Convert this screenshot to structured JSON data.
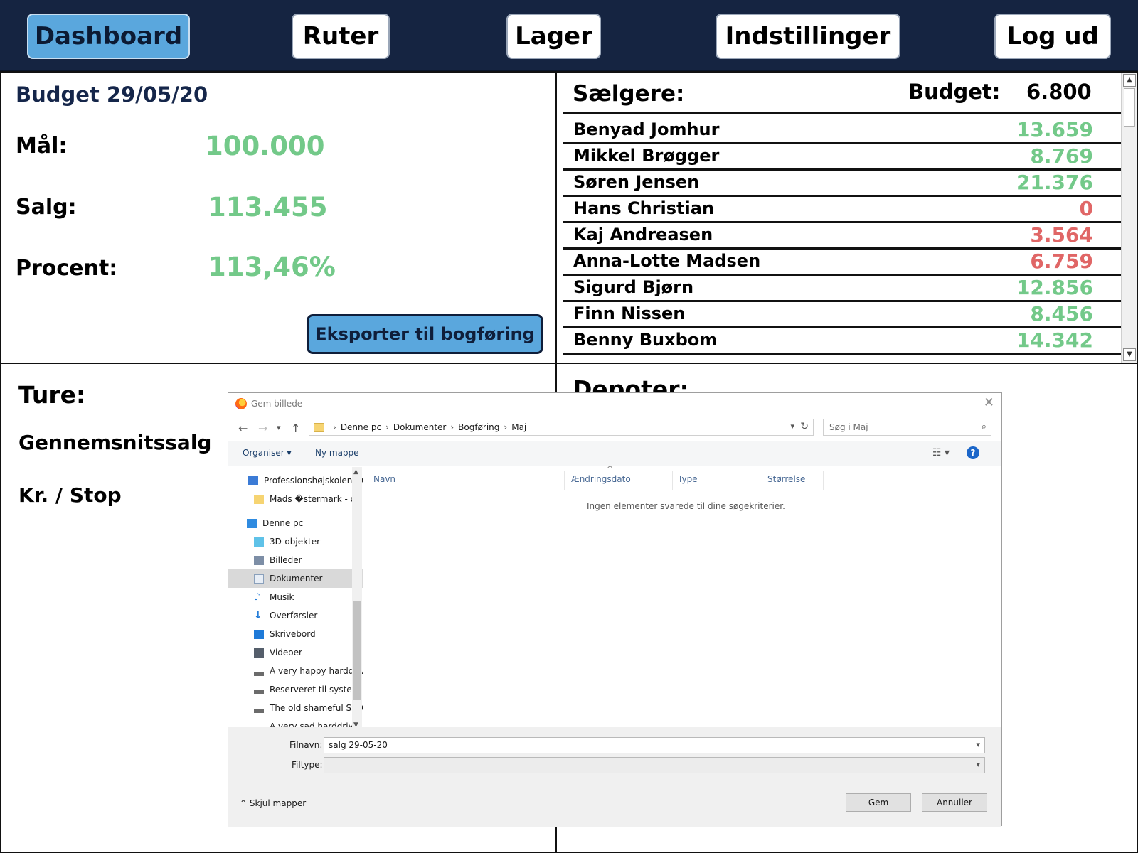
{
  "nav": {
    "items": [
      {
        "label": "Dashboard",
        "active": true
      },
      {
        "label": "Ruter"
      },
      {
        "label": "Lager"
      },
      {
        "label": "Indstillinger"
      },
      {
        "label": "Log ud"
      }
    ]
  },
  "budget": {
    "title": "Budget 29/05/20",
    "goal_label": "Mål:",
    "goal_value": "100.000",
    "sales_label": "Salg:",
    "sales_value": "113.455",
    "percent_label": "Procent:",
    "percent_value": "113,46%",
    "export_button": "Eksporter til bogføring"
  },
  "sellers": {
    "title": "Sælgere:",
    "budget_label": "Budget:",
    "budget_value": "6.800",
    "rows": [
      {
        "name": "Benyad Jomhur",
        "value": "13.659",
        "status": "green"
      },
      {
        "name": "Mikkel Brøgger",
        "value": "8.769",
        "status": "green"
      },
      {
        "name": "Søren Jensen",
        "value": "21.376",
        "status": "green"
      },
      {
        "name": "Hans Christian",
        "value": "0",
        "status": "red"
      },
      {
        "name": "Kaj Andreasen",
        "value": "3.564",
        "status": "red"
      },
      {
        "name": "Anna-Lotte Madsen",
        "value": "6.759",
        "status": "red"
      },
      {
        "name": "Sigurd Bjørn",
        "value": "12.856",
        "status": "green"
      },
      {
        "name": "Finn Nissen",
        "value": "8.456",
        "status": "green"
      },
      {
        "name": "Benny Buxbom",
        "value": "14.342",
        "status": "green"
      }
    ]
  },
  "tours": {
    "title": "Ture:",
    "avg_label": "Gennemsnitssalg",
    "per_stop_label": "Kr. / Stop"
  },
  "depots": {
    "title": "Depoter:"
  },
  "dialog": {
    "title": "Gem billede",
    "breadcrumbs": [
      "Denne pc",
      "Dokumenter",
      "Bogføring",
      "Maj"
    ],
    "search_placeholder": "Søg i Maj",
    "toolbar": {
      "organize": "Organiser",
      "new_folder": "Ny mappe"
    },
    "nav_items": [
      {
        "label": "Professionshøjskolen UCN",
        "icon": "building-icon"
      },
      {
        "label": "Mads �stermark - d",
        "icon": "folder-icon"
      },
      {
        "label": "Denne pc",
        "icon": "computer-icon"
      },
      {
        "label": "3D-objekter",
        "icon": "cube-icon"
      },
      {
        "label": "Billeder",
        "icon": "pictures-icon"
      },
      {
        "label": "Dokumenter",
        "icon": "documents-icon",
        "selected": true
      },
      {
        "label": "Musik",
        "icon": "music-icon"
      },
      {
        "label": "Overførsler",
        "icon": "download-icon"
      },
      {
        "label": "Skrivebord",
        "icon": "desktop-icon"
      },
      {
        "label": "Videoer",
        "icon": "video-icon"
      },
      {
        "label": "A very happy harddrive",
        "icon": "drive-icon"
      },
      {
        "label": "Reserveret til system",
        "icon": "drive-icon"
      },
      {
        "label": "The old shameful SSD",
        "icon": "drive-icon"
      },
      {
        "label": "A very sad harddrive",
        "icon": "drive-icon"
      }
    ],
    "columns": [
      "Navn",
      "Ændringsdato",
      "Type",
      "Størrelse"
    ],
    "empty_message": "Ingen elementer svarede til dine søgekriterier.",
    "filename_label": "Filnavn:",
    "filename_value": "salg 29-05-20",
    "filetype_label": "Filtype:",
    "filetype_value": "",
    "hide_folders": "Skjul mapper",
    "save_button": "Gem",
    "cancel_button": "Annuller"
  },
  "colors": {
    "nav_bg": "#152441",
    "active_tab": "#5aa7dd",
    "positive": "#73c989",
    "negative": "#e06666"
  }
}
